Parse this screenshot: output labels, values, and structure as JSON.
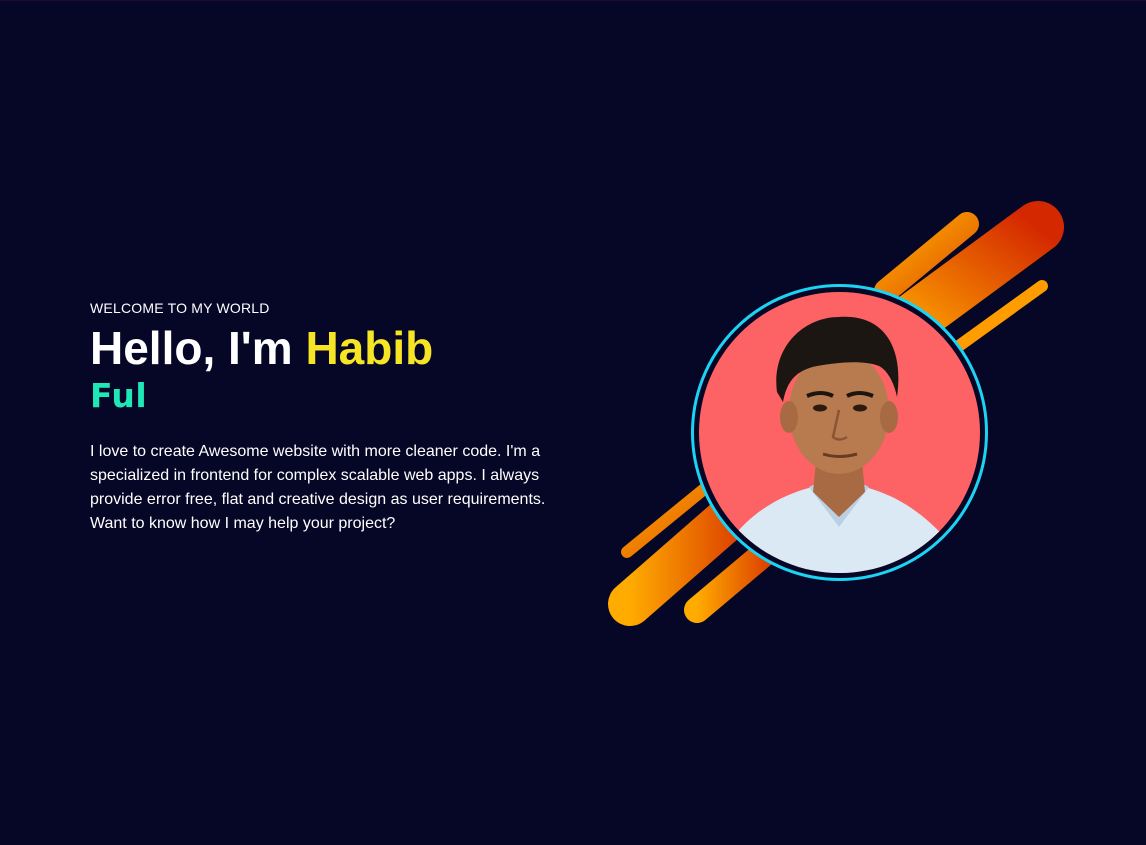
{
  "hero": {
    "eyebrow": "WELCOME TO MY WORLD",
    "headline_prefix": "Hello, I'm ",
    "headline_name": "Habib",
    "typed_text": "Ful",
    "intro": "I love to create Awesome website with more cleaner code. I'm a specialized in frontend for complex scalable web apps. I always provide error free, flat and creative design as user requirements. Want to know how I may help your project?"
  },
  "colors": {
    "background": "#060626",
    "name_accent": "#f6e524",
    "typed_accent": "#1ee8b5",
    "ring": "#1dd3f3",
    "avatar_bg": "#fd6264",
    "stripe_start": "#ffab00",
    "stripe_end": "#d42800"
  },
  "graphic": {
    "avatar_alt": "profile photo",
    "decoration": "diagonal-gradient-stripes"
  }
}
